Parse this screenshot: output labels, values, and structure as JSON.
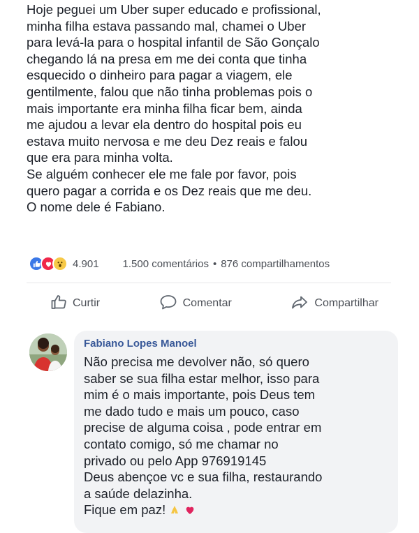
{
  "post": {
    "lines": [
      "Hoje peguei um Uber super educado e profissional,",
      "minha filha estava passando mal, chamei o Uber",
      "para levá-la para o hospital infantil de São Gonçalo",
      "chegando lá na presa em me dei conta que tinha",
      "esquecido o dinheiro para pagar a viagem, ele",
      "gentilmente,  falou que não tinha problemas pois o",
      "mais importante era minha filha ficar bem, ainda",
      "me ajudou a levar ela dentro do hospital pois eu",
      "estava muito nervosa e me deu Dez reais e falou",
      "que era para minha volta.",
      "Se alguém conhecer ele me fale por favor, pois",
      "quero pagar a corrida e os Dez reais que me deu.",
      "O nome dele é Fabiano."
    ]
  },
  "stats": {
    "reaction_icons": [
      "like-icon",
      "love-icon",
      "wow-icon"
    ],
    "reaction_count": "4.901",
    "comments": "1.500 comentários",
    "separator": "•",
    "shares": "876 compartilhamentos"
  },
  "actions": {
    "like_label": "Curtir",
    "comment_label": "Comentar",
    "share_label": "Compartilhar"
  },
  "comment": {
    "author": "Fabiano Lopes Manoel",
    "lines": [
      "Não precisa me devolver não, só quero",
      "saber se sua filha estar melhor, isso para",
      "mim é o mais importante, pois Deus tem",
      "me dado tudo e mais um pouco, caso",
      "precise de alguma coisa , pode entrar em",
      "contato comigo, só me chamar no",
      "privado ou pelo App 976919145",
      "Deus abençoe vc e sua filha, restaurando",
      "a saúde delazinha.",
      "Fique em paz!"
    ],
    "trailing_icons": [
      "praying-hands-icon",
      "heart-icon"
    ]
  },
  "colors": {
    "like": "#3b78e7",
    "love": "#f0284a",
    "wow": "#f7c948",
    "author_link": "#385898",
    "bubble": "#f2f3f5"
  }
}
